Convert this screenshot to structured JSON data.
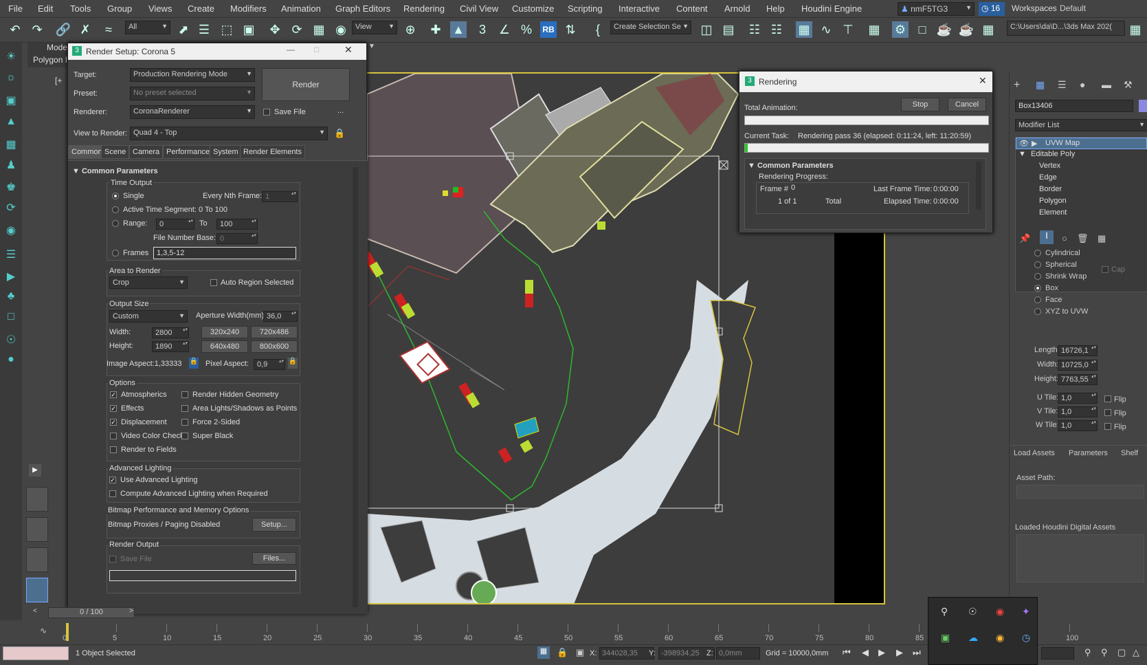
{
  "menu": [
    "File",
    "Edit",
    "Tools",
    "Group",
    "Views",
    "Create",
    "Modifiers",
    "Animation",
    "Graph Editors",
    "Rendering",
    "Civil View",
    "Customize",
    "Scripting",
    "Interactive",
    "Content",
    "Arnold",
    "Help",
    "Houdini Engine"
  ],
  "user": "nmF5TG3",
  "notif_count": "16",
  "workspaces_label": "Workspaces:",
  "workspace": "Default",
  "toolbar": {
    "filter": "All",
    "view": "View",
    "create_sel": "Create Selection Se",
    "path": "C:\\Users\\da\\D...\\3ds Max 202("
  },
  "ribbon": {
    "mode": "Mode",
    "polygon": "Polygon I"
  },
  "render_setup": {
    "title": "Render Setup: Corona 5",
    "target_label": "Target:",
    "target": "Production Rendering Mode",
    "preset_label": "Preset:",
    "preset": "No preset selected",
    "renderer_label": "Renderer:",
    "renderer": "CoronaRenderer",
    "save_file": "Save File",
    "view_label": "View to Render:",
    "view": "Quad 4 - Top",
    "render_btn": "Render",
    "dots": "...",
    "tabs": [
      "Common",
      "Scene",
      "Camera",
      "Performance",
      "System",
      "Render Elements"
    ],
    "rollout": "Common Parameters",
    "time_output": "Time Output",
    "single": "Single",
    "every_nth": "Every Nth Frame:",
    "every_nth_val": "1",
    "active_seg": "Active Time Segment:",
    "active_seg_val": "0 To 100",
    "range": "Range:",
    "range_from": "0",
    "to": "To",
    "range_to": "100",
    "file_num": "File Number Base:",
    "file_num_val": "0",
    "frames": "Frames",
    "frames_val": "1,3,5-12",
    "area": "Area to Render",
    "area_val": "Crop",
    "auto_region": "Auto Region Selected",
    "output_size": "Output Size",
    "size_preset": "Custom",
    "aperture": "Aperture Width(mm):",
    "aperture_val": "36,0",
    "width": "Width:",
    "width_val": "2800",
    "height": "Height:",
    "height_val": "1890",
    "presets": [
      "320x240",
      "720x486",
      "640x480",
      "800x600"
    ],
    "image_aspect": "Image Aspect:1,33333",
    "pixel_aspect": "Pixel Aspect:",
    "pixel_aspect_val": "0,9",
    "options": "Options",
    "opts_left": [
      {
        "t": "Atmospherics",
        "c": true
      },
      {
        "t": "Effects",
        "c": true
      },
      {
        "t": "Displacement",
        "c": true
      },
      {
        "t": "Video Color Check",
        "c": false
      },
      {
        "t": "Render to Fields",
        "c": false
      }
    ],
    "opts_right": [
      {
        "t": "Render Hidden Geometry"
      },
      {
        "t": "Area Lights/Shadows as Points"
      },
      {
        "t": "Force 2-Sided"
      },
      {
        "t": "Super Black"
      }
    ],
    "adv": "Advanced Lighting",
    "use_adv": "Use Advanced Lighting",
    "compute_adv": "Compute Advanced Lighting when Required",
    "bitmap": "Bitmap Performance and Memory Options",
    "bitmap_proxies": "Bitmap Proxies / Paging Disabled",
    "setup": "Setup...",
    "render_output": "Render Output",
    "save_file2": "Save File",
    "files": "Files..."
  },
  "rendering": {
    "title": "Rendering",
    "total_anim": "Total Animation:",
    "stop": "Stop",
    "cancel": "Cancel",
    "current_task": "Current Task:",
    "task": "Rendering pass 36 (elapsed: 0:11:24, left: 11:20:59)",
    "progress_total": 0.0,
    "progress_task": 0.01,
    "rollout": "Common Parameters",
    "rendering_progress": "Rendering Progress:",
    "frame": "Frame #",
    "frame_val": "0",
    "last_frame": "Last Frame Time:",
    "last_frame_val": "0:00:00",
    "of": "1 of 1",
    "total": "Total",
    "elapsed": "Elapsed Time:",
    "elapsed_val": "0:00:00"
  },
  "cmd": {
    "object_name": "Box13406",
    "modifier_list": "Modifier List",
    "stack": [
      "UVW Map",
      "Editable Poly",
      "Vertex",
      "Edge",
      "Border",
      "Polygon",
      "Element"
    ],
    "mapping": [
      "Cylindrical",
      "Spherical",
      "Shrink Wrap",
      "Box",
      "Face",
      "XYZ to UVW"
    ],
    "cap": "Cap",
    "length": "Length:",
    "length_val": "16726,1",
    "width": "Width:",
    "width_val": "10725,0",
    "height": "Height:",
    "height_val": "7763,55",
    "utile": "U Tile:",
    "utile_val": "1,0",
    "vtile": "V Tile:",
    "vtile_val": "1,0",
    "wtile": "W Tile:",
    "wtile_val": "1,0",
    "flip": "Flip",
    "tabs": [
      "Load Assets",
      "Parameters",
      "Shelf"
    ],
    "asset_path": "Asset Path:",
    "loaded_hda": "Loaded Houdini Digital Assets"
  },
  "timeline": {
    "frame": "0 / 100",
    "ticks": [
      "0",
      "5",
      "10",
      "15",
      "20",
      "25",
      "30",
      "35",
      "40",
      "45",
      "50",
      "55",
      "60",
      "65",
      "70",
      "75",
      "80",
      "85",
      "90",
      "95",
      "100"
    ]
  },
  "status": {
    "selected": "1 Object Selected",
    "x_label": "X:",
    "x": "344028,35",
    "y_label": "Y:",
    "y": "-398934,25",
    "z_label": "Z:",
    "z": "0,0mm",
    "grid": "Grid = 10000,0mm"
  }
}
